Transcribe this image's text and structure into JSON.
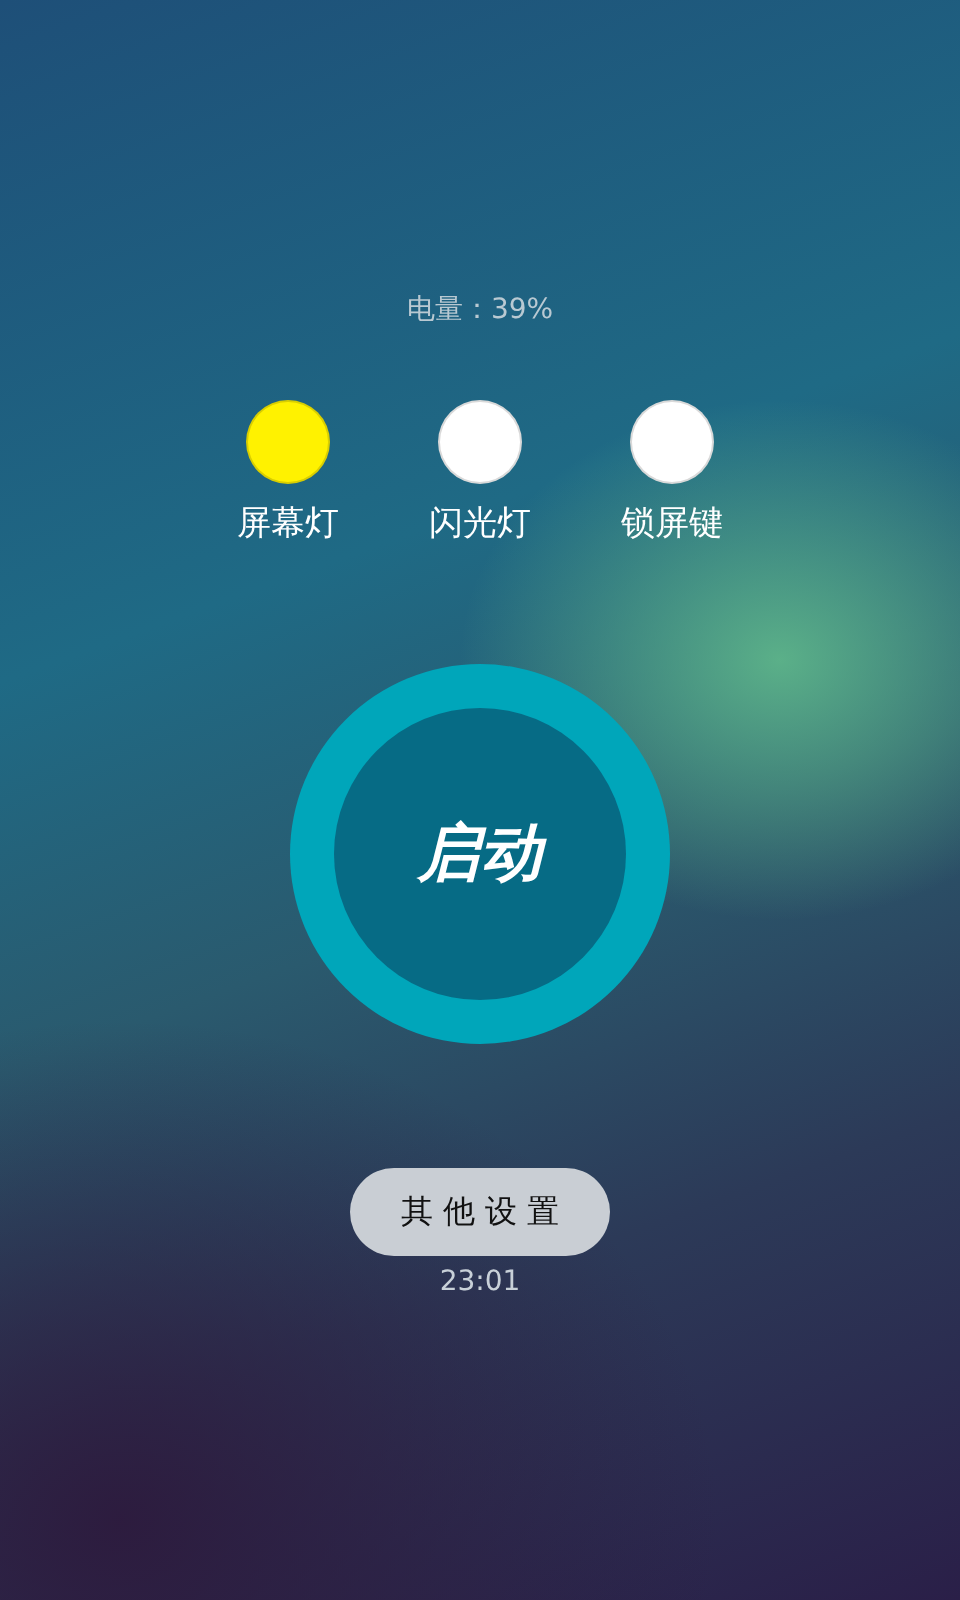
{
  "battery": "电量：39%",
  "toggles": [
    {
      "label": "屏幕灯",
      "on": true
    },
    {
      "label": "闪光灯",
      "on": false
    },
    {
      "label": "锁屏键",
      "on": false
    }
  ],
  "start_button": "启动",
  "settings_button": "其 他 设 置",
  "time": "23:01"
}
